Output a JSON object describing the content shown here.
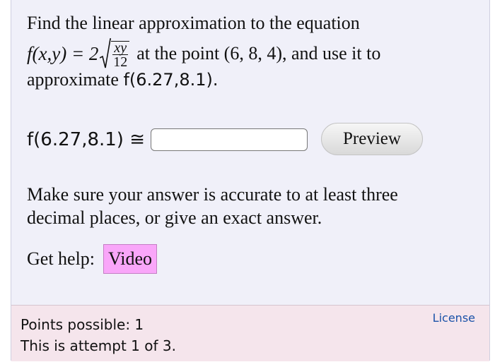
{
  "question": {
    "line1": "Find the linear approximation to the equation",
    "func_lhs": "f(x,y) = 2",
    "sqrt_numerator": "xy",
    "sqrt_denominator": "12",
    "line2_rest": "at the point (6, 8, 4), and use it to",
    "line3_text": "approximate",
    "line3_expr": "f(6.27,8.1)."
  },
  "answer": {
    "label": "f(6.27,8.1) ≅",
    "value": "",
    "preview_label": "Preview"
  },
  "note": "Make sure your answer is accurate to at least three decimal places, or give an exact answer.",
  "help": {
    "label": "Get help:",
    "video_label": "Video"
  },
  "footer": {
    "points": "Points possible: 1",
    "attempt": "This is attempt 1 of 3.",
    "license": "License"
  },
  "colors": {
    "card_bg": "#f0f0f9",
    "footer_bg": "#f5e5ec",
    "video_bg": "#f9a6f9",
    "license_link": "#1a52a8"
  }
}
